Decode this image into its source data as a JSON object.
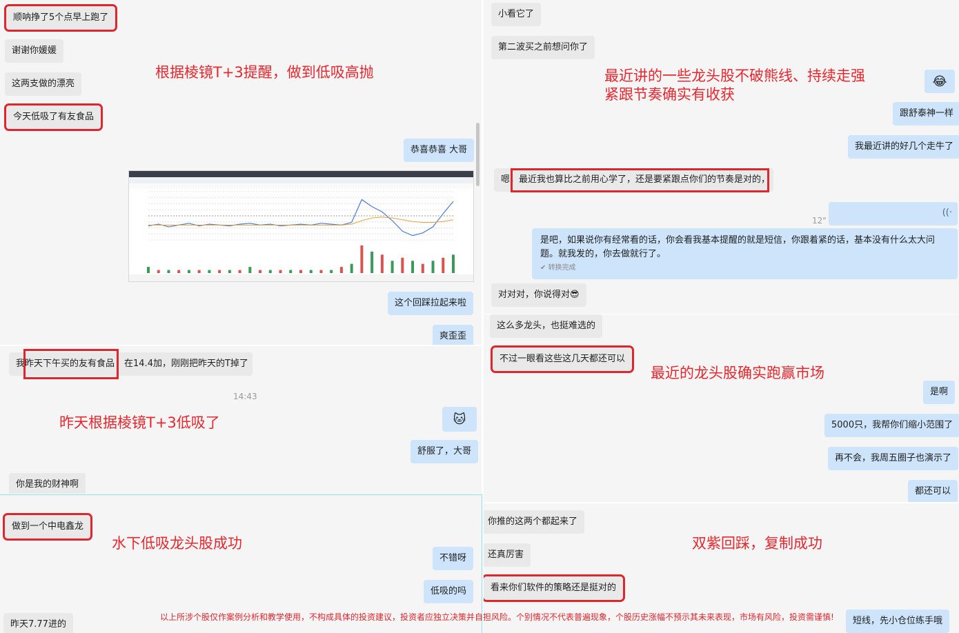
{
  "colors": {
    "annotation": "#e8262d",
    "incoming": "#e9e9e9",
    "outgoing": "#cde4fb",
    "highlight": "#e0262d"
  },
  "panel1": {
    "msgs": [
      "顺呐挣了5个点早上跑了",
      "谢谢你媛媛",
      "这两支做的漂亮",
      "今天低吸了有友食品",
      "恭喜恭喜 大哥",
      "这个回踩拉起来啦",
      "爽歪歪"
    ],
    "note": "根据棱镜T+3提醒，做到低吸高抛"
  },
  "panel2": {
    "msg1": "我昨天下午买的友有食品",
    "msg1_tail": "在14.4加，刚刚把昨天的T掉了",
    "time": "14:43",
    "emoji": "🐱",
    "msgs": [
      "舒服了，大哥",
      "你是我的财神啊"
    ],
    "note": "昨天根据棱镜T+3低吸了"
  },
  "panel3": {
    "msgs": [
      "做到一个中电鑫龙",
      "不错呀",
      "低吸的吗",
      "昨天7.77进的"
    ],
    "note": "水下低吸龙头股成功"
  },
  "panel4": {
    "msgs": [
      "小看它了",
      "第二波买之前想问你了",
      "跟舒泰神一样",
      "我最近讲的好几个走牛了"
    ],
    "emoji": "😂",
    "msg_prefix": "嗯，",
    "msg_hl": "最近我也算比之前用心学了，还是要紧跟点你们的节奏是对的，",
    "voice_len": "12\"",
    "quote": "是吧，如果说你有经常看的话，你会看我基本提醒的就是短信，你跟着紧的话，基本没有什么太大问题。就我发的，你去做就行了。",
    "quote_sub": "转换完成",
    "msg_last": "对对对，你说得对😎",
    "note_line1": "最近讲的一些龙头股不破熊线、持续走强",
    "note_line2": "紧跟节奏确实有收获"
  },
  "panel5": {
    "msgs": [
      "这么多龙头，也挺难选的",
      "不过一眼看这些这几天都还可以",
      "是啊",
      "5000只，我帮你们缩小范围了",
      "再不会，我周五圈子也演示了",
      "都还可以"
    ],
    "note": "最近的龙头股确实跑赢市场"
  },
  "panel6": {
    "msgs": [
      "你推的这两个都起来了",
      "还真厉害",
      "看来你们软件的策略还是挺对的",
      "短线，先小仓位练手哦"
    ],
    "note": "双紫回踩，复制成功"
  },
  "disclaimer": "以上所涉个股仅作案例分析和教学使用，不构成具体的投资建议，投资者应独立决策并自担风险。个别情况不代表普遍现象，个股历史涨幅不预示其未来表现，市场有风险，投资需谨慎!",
  "chart_data": {
    "type": "line",
    "title": "",
    "series": [
      {
        "name": "price",
        "values": [
          14.36,
          14.38,
          14.35,
          14.37,
          14.39,
          14.36,
          14.38,
          14.37,
          14.36,
          14.38,
          14.39,
          14.37,
          14.38,
          14.36,
          14.37,
          14.38,
          14.37,
          14.39,
          14.38,
          14.37,
          14.4,
          14.66,
          14.58,
          14.52,
          14.42,
          14.3,
          14.25,
          14.28,
          14.35,
          14.5,
          14.64
        ]
      },
      {
        "name": "avg",
        "values": [
          14.37,
          14.37,
          14.37,
          14.37,
          14.37,
          14.37,
          14.37,
          14.37,
          14.37,
          14.37,
          14.37,
          14.37,
          14.37,
          14.37,
          14.37,
          14.37,
          14.37,
          14.37,
          14.37,
          14.37,
          14.38,
          14.42,
          14.45,
          14.46,
          14.45,
          14.43,
          14.41,
          14.4,
          14.4,
          14.41,
          14.43
        ]
      }
    ],
    "volume": [
      2,
      1,
      1,
      1,
      1,
      1,
      1,
      1,
      1,
      1,
      2,
      1,
      1,
      1,
      1,
      1,
      1,
      1,
      1,
      2,
      3,
      9,
      7,
      6,
      4,
      5,
      4,
      3,
      4,
      5,
      6
    ],
    "ylim": [
      14.2,
      14.75
    ]
  }
}
